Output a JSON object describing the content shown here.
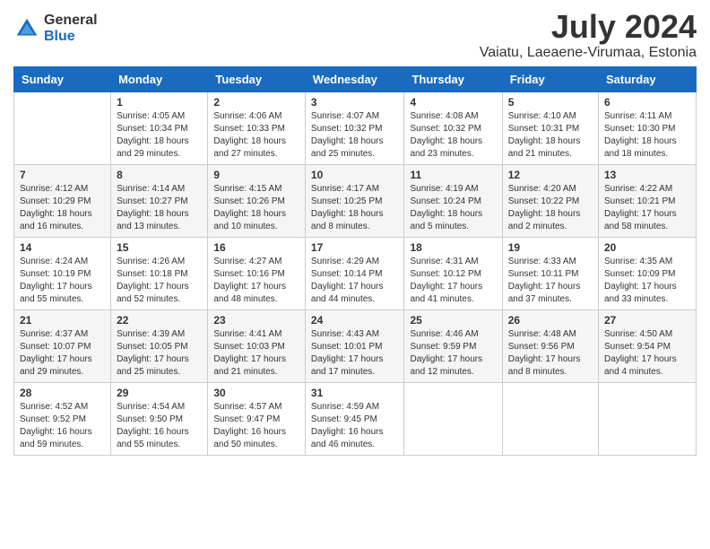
{
  "header": {
    "logo_general": "General",
    "logo_blue": "Blue",
    "month_title": "July 2024",
    "location": "Vaiatu, Laeaene-Virumaa, Estonia"
  },
  "days_of_week": [
    "Sunday",
    "Monday",
    "Tuesday",
    "Wednesday",
    "Thursday",
    "Friday",
    "Saturday"
  ],
  "weeks": [
    [
      {
        "day": "",
        "info": ""
      },
      {
        "day": "1",
        "info": "Sunrise: 4:05 AM\nSunset: 10:34 PM\nDaylight: 18 hours\nand 29 minutes."
      },
      {
        "day": "2",
        "info": "Sunrise: 4:06 AM\nSunset: 10:33 PM\nDaylight: 18 hours\nand 27 minutes."
      },
      {
        "day": "3",
        "info": "Sunrise: 4:07 AM\nSunset: 10:32 PM\nDaylight: 18 hours\nand 25 minutes."
      },
      {
        "day": "4",
        "info": "Sunrise: 4:08 AM\nSunset: 10:32 PM\nDaylight: 18 hours\nand 23 minutes."
      },
      {
        "day": "5",
        "info": "Sunrise: 4:10 AM\nSunset: 10:31 PM\nDaylight: 18 hours\nand 21 minutes."
      },
      {
        "day": "6",
        "info": "Sunrise: 4:11 AM\nSunset: 10:30 PM\nDaylight: 18 hours\nand 18 minutes."
      }
    ],
    [
      {
        "day": "7",
        "info": "Sunrise: 4:12 AM\nSunset: 10:29 PM\nDaylight: 18 hours\nand 16 minutes."
      },
      {
        "day": "8",
        "info": "Sunrise: 4:14 AM\nSunset: 10:27 PM\nDaylight: 18 hours\nand 13 minutes."
      },
      {
        "day": "9",
        "info": "Sunrise: 4:15 AM\nSunset: 10:26 PM\nDaylight: 18 hours\nand 10 minutes."
      },
      {
        "day": "10",
        "info": "Sunrise: 4:17 AM\nSunset: 10:25 PM\nDaylight: 18 hours\nand 8 minutes."
      },
      {
        "day": "11",
        "info": "Sunrise: 4:19 AM\nSunset: 10:24 PM\nDaylight: 18 hours\nand 5 minutes."
      },
      {
        "day": "12",
        "info": "Sunrise: 4:20 AM\nSunset: 10:22 PM\nDaylight: 18 hours\nand 2 minutes."
      },
      {
        "day": "13",
        "info": "Sunrise: 4:22 AM\nSunset: 10:21 PM\nDaylight: 17 hours\nand 58 minutes."
      }
    ],
    [
      {
        "day": "14",
        "info": "Sunrise: 4:24 AM\nSunset: 10:19 PM\nDaylight: 17 hours\nand 55 minutes."
      },
      {
        "day": "15",
        "info": "Sunrise: 4:26 AM\nSunset: 10:18 PM\nDaylight: 17 hours\nand 52 minutes."
      },
      {
        "day": "16",
        "info": "Sunrise: 4:27 AM\nSunset: 10:16 PM\nDaylight: 17 hours\nand 48 minutes."
      },
      {
        "day": "17",
        "info": "Sunrise: 4:29 AM\nSunset: 10:14 PM\nDaylight: 17 hours\nand 44 minutes."
      },
      {
        "day": "18",
        "info": "Sunrise: 4:31 AM\nSunset: 10:12 PM\nDaylight: 17 hours\nand 41 minutes."
      },
      {
        "day": "19",
        "info": "Sunrise: 4:33 AM\nSunset: 10:11 PM\nDaylight: 17 hours\nand 37 minutes."
      },
      {
        "day": "20",
        "info": "Sunrise: 4:35 AM\nSunset: 10:09 PM\nDaylight: 17 hours\nand 33 minutes."
      }
    ],
    [
      {
        "day": "21",
        "info": "Sunrise: 4:37 AM\nSunset: 10:07 PM\nDaylight: 17 hours\nand 29 minutes."
      },
      {
        "day": "22",
        "info": "Sunrise: 4:39 AM\nSunset: 10:05 PM\nDaylight: 17 hours\nand 25 minutes."
      },
      {
        "day": "23",
        "info": "Sunrise: 4:41 AM\nSunset: 10:03 PM\nDaylight: 17 hours\nand 21 minutes."
      },
      {
        "day": "24",
        "info": "Sunrise: 4:43 AM\nSunset: 10:01 PM\nDaylight: 17 hours\nand 17 minutes."
      },
      {
        "day": "25",
        "info": "Sunrise: 4:46 AM\nSunset: 9:59 PM\nDaylight: 17 hours\nand 12 minutes."
      },
      {
        "day": "26",
        "info": "Sunrise: 4:48 AM\nSunset: 9:56 PM\nDaylight: 17 hours\nand 8 minutes."
      },
      {
        "day": "27",
        "info": "Sunrise: 4:50 AM\nSunset: 9:54 PM\nDaylight: 17 hours\nand 4 minutes."
      }
    ],
    [
      {
        "day": "28",
        "info": "Sunrise: 4:52 AM\nSunset: 9:52 PM\nDaylight: 16 hours\nand 59 minutes."
      },
      {
        "day": "29",
        "info": "Sunrise: 4:54 AM\nSunset: 9:50 PM\nDaylight: 16 hours\nand 55 minutes."
      },
      {
        "day": "30",
        "info": "Sunrise: 4:57 AM\nSunset: 9:47 PM\nDaylight: 16 hours\nand 50 minutes."
      },
      {
        "day": "31",
        "info": "Sunrise: 4:59 AM\nSunset: 9:45 PM\nDaylight: 16 hours\nand 46 minutes."
      },
      {
        "day": "",
        "info": ""
      },
      {
        "day": "",
        "info": ""
      },
      {
        "day": "",
        "info": ""
      }
    ]
  ]
}
